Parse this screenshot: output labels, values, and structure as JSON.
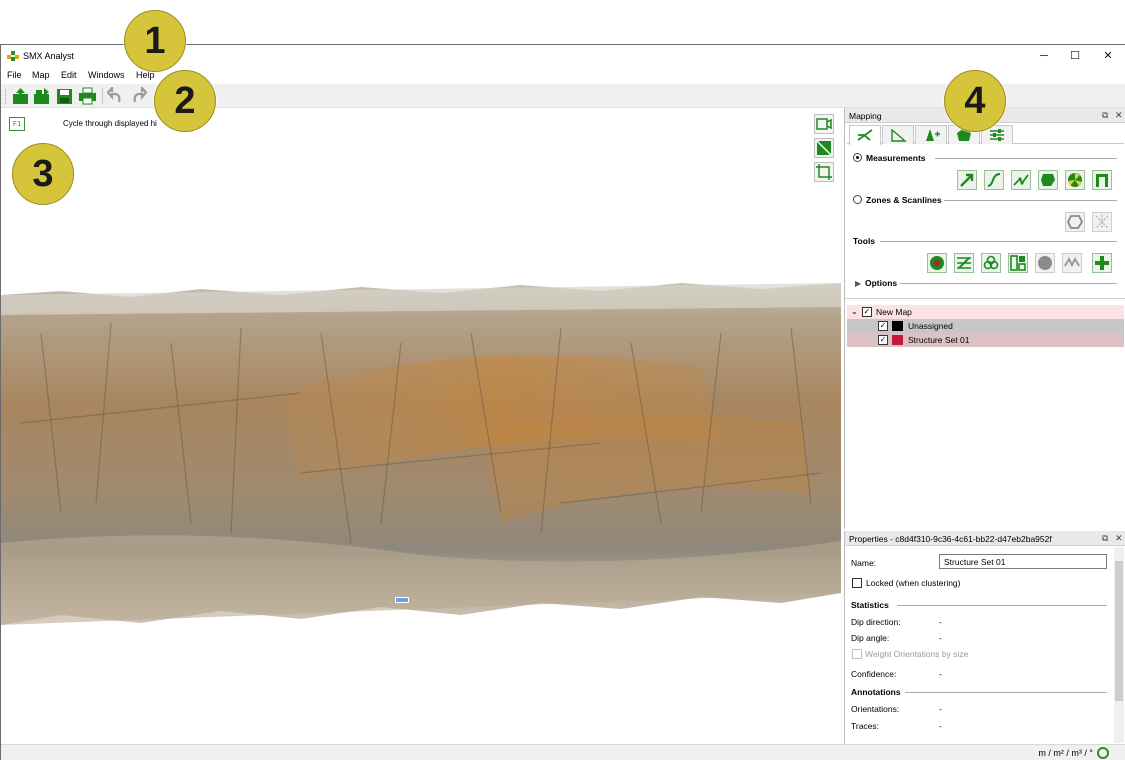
{
  "window": {
    "title": "SMX Analyst",
    "controls": {
      "minimize": "─",
      "maximize": "☐",
      "close": "✕"
    }
  },
  "menu": [
    "File",
    "Map",
    "Edit",
    "Windows",
    "Help"
  ],
  "toolbar": {
    "icons": [
      "open-project-icon",
      "import-icon",
      "save-icon",
      "print-icon",
      "undo-icon",
      "redo-icon"
    ],
    "accent_color": "#1e8a1e"
  },
  "viewport": {
    "hint_key": "F1",
    "hint_text": "Cycle through displayed hi",
    "view_tools": [
      "camera-view-icon",
      "toggle-overlay-icon",
      "crop-view-icon"
    ]
  },
  "mapping_panel": {
    "title": "Mapping",
    "tabs": [
      "measure-tab-icon",
      "scanline-tab-icon",
      "points-tab-icon",
      "zones-tab-icon",
      "settings-tab-icon"
    ],
    "sections": {
      "measurements": "Measurements",
      "zones": "Zones & Scanlines",
      "tools": "Tools",
      "options": "Options"
    },
    "selected_mode": "Measurements",
    "tree": {
      "root": "New Map",
      "items": [
        {
          "label": "Unassigned",
          "color": "#000000",
          "row_color": "#c7c7c7"
        },
        {
          "label": "Structure Set 01",
          "color": "#c4183c",
          "row_color": "#dcc2c4"
        }
      ],
      "root_row_color": "#fbe3e3"
    }
  },
  "properties_panel": {
    "title": "Properties - c8d4f310-9c36-4c61-bb22-d47eb2ba952f",
    "name_label": "Name:",
    "name_value": "Structure Set 01",
    "locked_label": "Locked (when clustering)",
    "statistics_heading": "Statistics",
    "dip_direction_label": "Dip direction:",
    "dip_direction_value": "-",
    "dip_angle_label": "Dip angle:",
    "dip_angle_value": "-",
    "weight_label": "Weight Orientations by size",
    "confidence_label": "Confidence:",
    "confidence_value": "-",
    "annotations_heading": "Annotations",
    "orientations_label": "Orientations:",
    "orientations_value": "-",
    "traces_label": "Traces:",
    "traces_value": "-"
  },
  "statusbar": {
    "units": "m / m² / m³ / °"
  },
  "callouts": [
    "1",
    "2",
    "3",
    "4"
  ],
  "callout_color": "#d6c43a"
}
